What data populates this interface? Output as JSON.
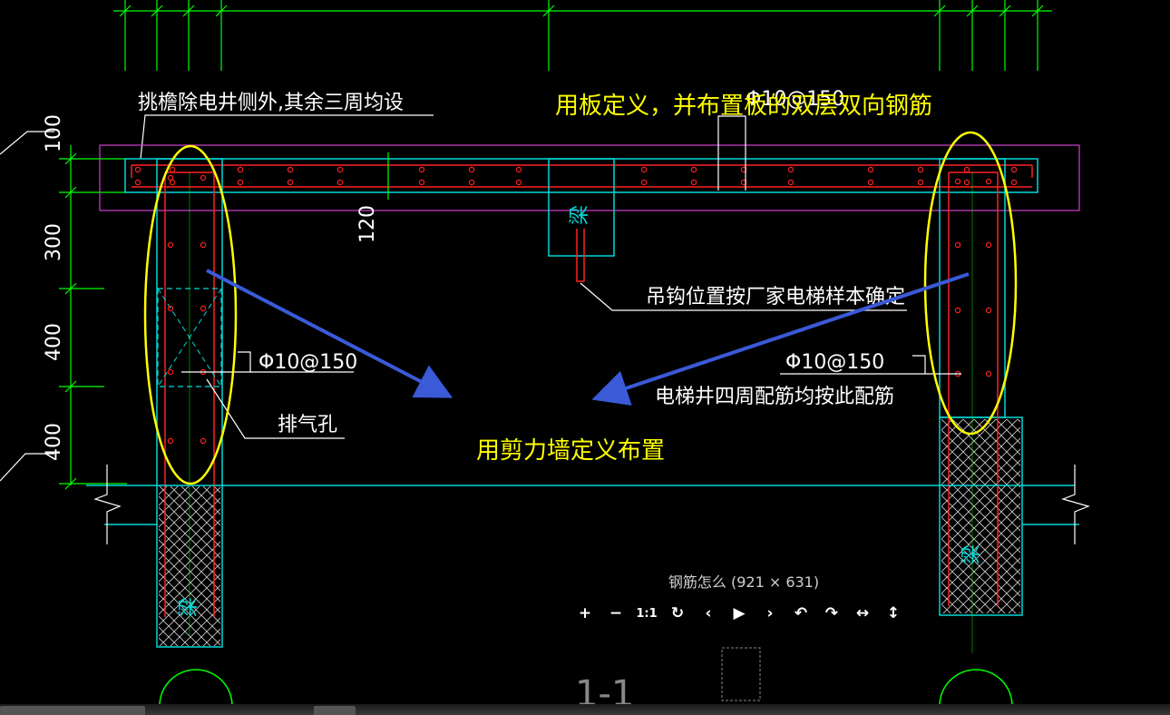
{
  "drawing": {
    "labels": {
      "top_note": "挑檐除电井侧外,其余三周均设",
      "rebar_top": "Φ10@150",
      "slab_thickness": "120",
      "beam_char": "梁",
      "hook_note": "吊钩位置按厂家电梯样本确定",
      "rebar_left": "Φ10@150",
      "rebar_right": "Φ10@150",
      "shaft_note": "电梯井四周配筋均按此配筋",
      "vent_note": "排气孔",
      "section_mark": "1-1"
    },
    "dimensions": [
      "100",
      "300",
      "400",
      "400"
    ],
    "colors": {
      "cyan": "#00d8d8",
      "green": "#00ff00",
      "red": "#ff2020",
      "white": "#ffffff",
      "magenta": "#d040d0",
      "annotation": "#ffff00",
      "arrow": "#3a5ad8"
    }
  },
  "annotations": {
    "slab_note": "用板定义，并布置板的双层双向钢筋",
    "wall_note": "用剪力墙定义布置"
  },
  "viewer": {
    "caption": "钢筋怎么 (921 × 631)",
    "buttons": [
      {
        "id": "zoom-in",
        "label": "+"
      },
      {
        "id": "zoom-out",
        "label": "−"
      },
      {
        "id": "actual-size",
        "label": "1:1"
      },
      {
        "id": "reset",
        "label": "↻"
      },
      {
        "id": "prev",
        "label": "‹"
      },
      {
        "id": "play",
        "label": "▶"
      },
      {
        "id": "next",
        "label": "›"
      },
      {
        "id": "rotate-left",
        "label": "↶"
      },
      {
        "id": "rotate-right",
        "label": "↷"
      },
      {
        "id": "flip-horizontal",
        "label": "↔"
      },
      {
        "id": "flip-vertical",
        "label": "↕"
      }
    ]
  }
}
